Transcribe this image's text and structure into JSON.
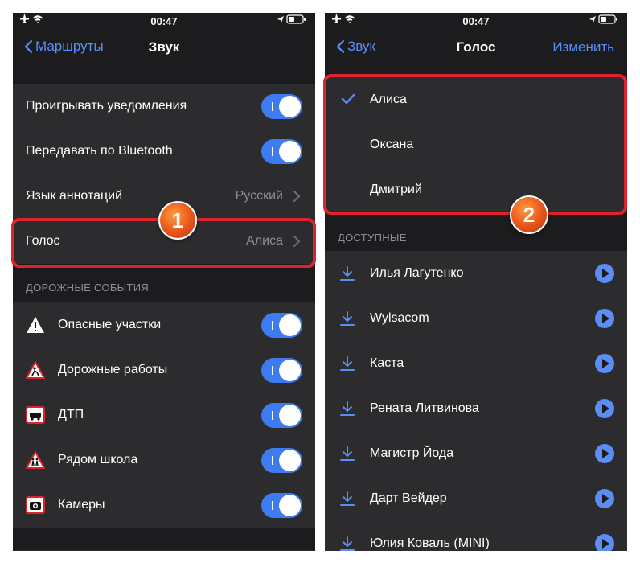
{
  "status": {
    "time": "00:47"
  },
  "left": {
    "nav": {
      "back": "Маршруты",
      "title": "Звук"
    },
    "rows": [
      {
        "label": "Проигрывать уведомления",
        "toggle": true
      },
      {
        "label": "Передавать по Bluetooth",
        "toggle": true
      },
      {
        "label": "Язык аннотаций",
        "value": "Русский"
      },
      {
        "label": "Голос",
        "value": "Алиса"
      }
    ],
    "section": "ДОРОЖНЫЕ СОБЫТИЯ",
    "events": [
      {
        "label": "Опасные участки",
        "icon": "warning-icon",
        "toggle": true
      },
      {
        "label": "Дорожные работы",
        "icon": "road-works-icon",
        "toggle": true
      },
      {
        "label": "ДТП",
        "icon": "accident-icon",
        "toggle": true
      },
      {
        "label": "Рядом школа",
        "icon": "school-icon",
        "toggle": true
      },
      {
        "label": "Камеры",
        "icon": "camera-icon",
        "toggle": true
      }
    ],
    "badge": "1"
  },
  "right": {
    "nav": {
      "back": "Звук",
      "title": "Голос",
      "action": "Изменить"
    },
    "installed": [
      {
        "label": "Алиса",
        "selected": true
      },
      {
        "label": "Оксана",
        "selected": false
      },
      {
        "label": "Дмитрий",
        "selected": false
      }
    ],
    "section": "ДОСТУПНЫЕ",
    "available": [
      {
        "label": "Илья Лагутенко"
      },
      {
        "label": "Wylsacom"
      },
      {
        "label": "Каста"
      },
      {
        "label": "Рената Литвинова"
      },
      {
        "label": "Магистр Йода"
      },
      {
        "label": "Дарт Вейдер"
      },
      {
        "label": "Юлия Коваль (MINI)"
      }
    ],
    "badge": "2"
  },
  "colors": {
    "accent": "#5a8ef6",
    "toggle_on": "#3d7cf0",
    "highlight": "#e0222a",
    "badge": "#e8541a"
  }
}
